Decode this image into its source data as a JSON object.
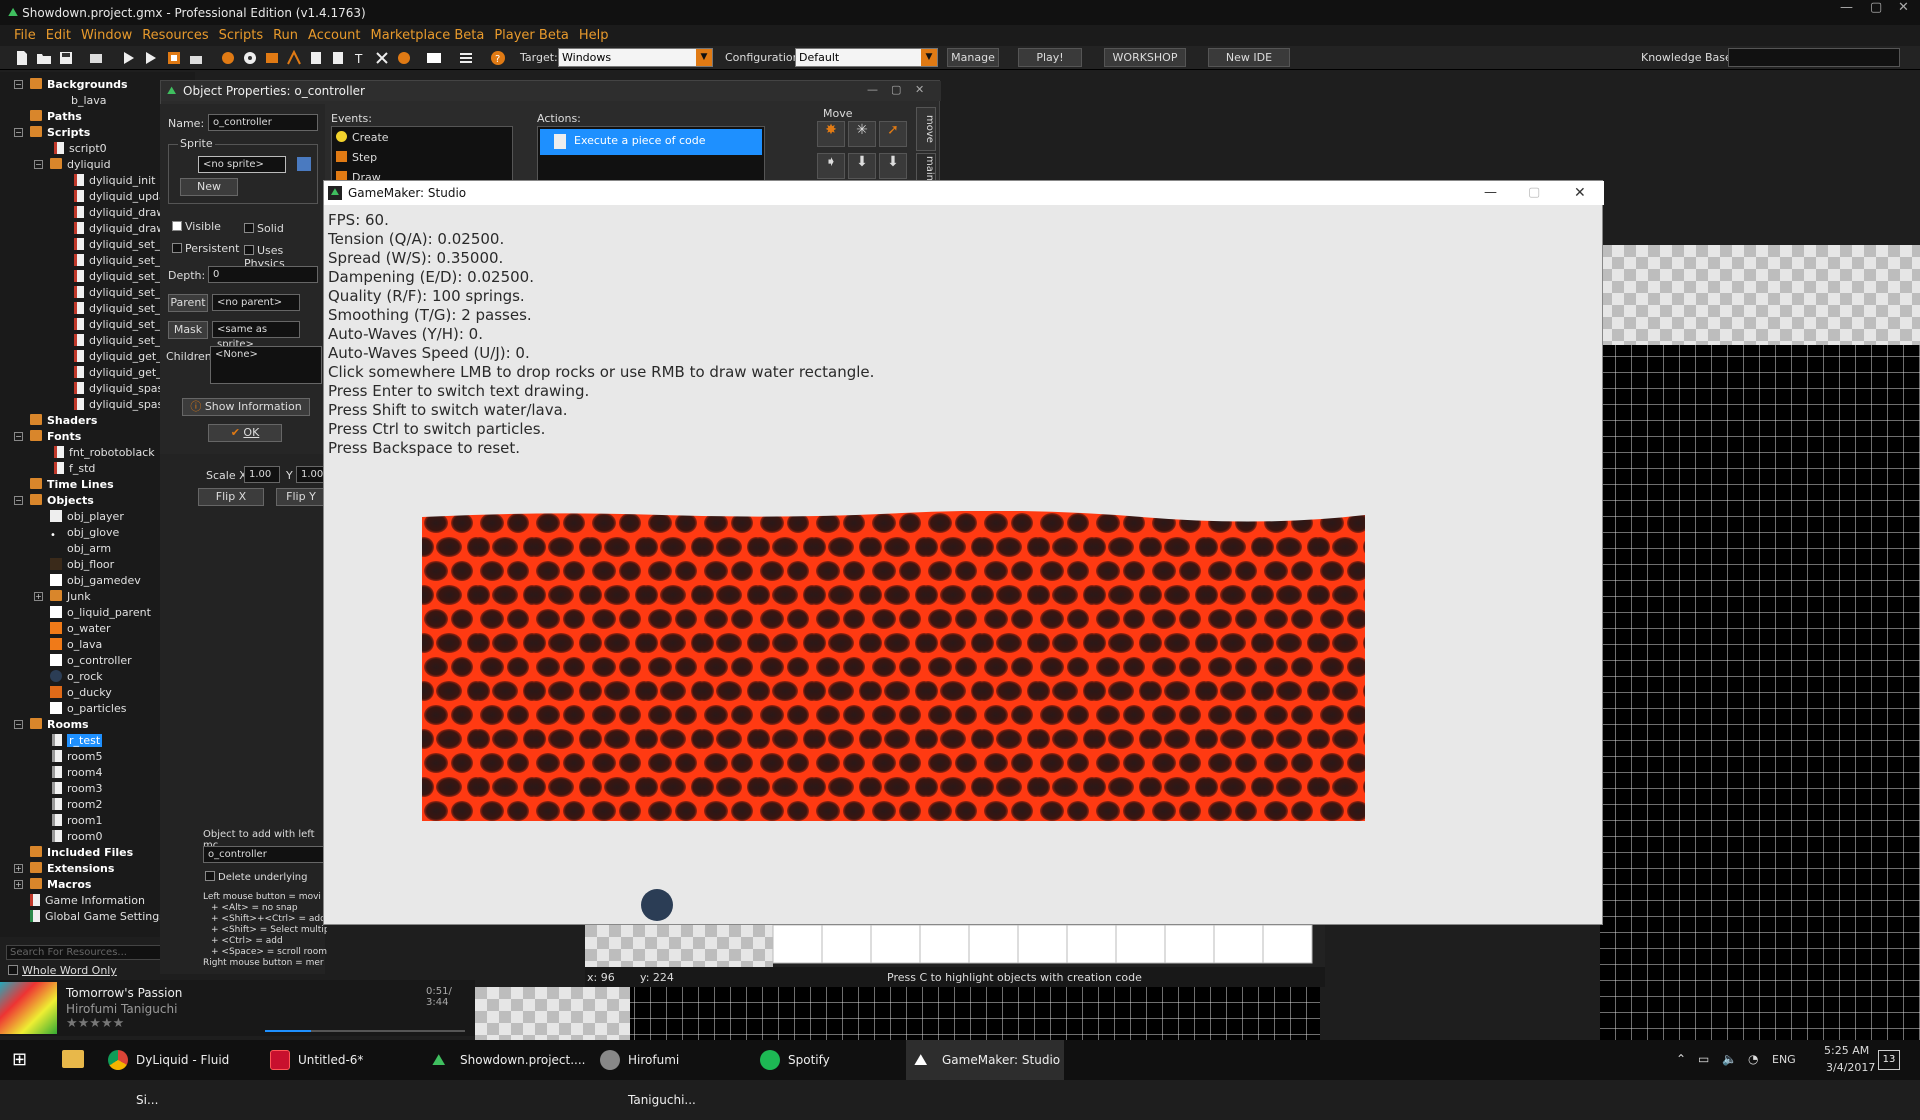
{
  "window": {
    "title": "Showdown.project.gmx - Professional Edition (v1.4.1763)"
  },
  "menu": [
    "File",
    "Edit",
    "Window",
    "Resources",
    "Scripts",
    "Run",
    "Account",
    "Marketplace Beta",
    "Player Beta",
    "Help"
  ],
  "toolbar": {
    "target_label": "Target:",
    "target_value": "Windows",
    "config_label": "Configuration:",
    "config_value": "Default",
    "manage": "Manage",
    "play": "Play!",
    "workshop": "WORKSHOP",
    "new_ide": "New IDE",
    "knowledge_label": "Knowledge Base:"
  },
  "tree": {
    "backgrounds": "Backgrounds",
    "b_lava": "b_lava",
    "paths": "Paths",
    "scripts": "Scripts",
    "script0": "script0",
    "dyliquid": "dyliquid",
    "scripts_list": [
      "dyliquid_init",
      "dyliquid_upda",
      "dyliquid_draw",
      "dyliquid_draw_",
      "dyliquid_set_b",
      "dyliquid_set_c",
      "dyliquid_set_t",
      "dyliquid_set_c",
      "dyliquid_set_s",
      "dyliquid_set_v",
      "dyliquid_set_s",
      "dyliquid_get_c",
      "dyliquid_get_s",
      "dyliquid_spash",
      "dyliquid_spash"
    ],
    "shaders": "Shaders",
    "fonts": "Fonts",
    "fonts_list": [
      "fnt_robotoblack",
      "f_std"
    ],
    "timelines": "Time Lines",
    "objects": "Objects",
    "objects_list": [
      "obj_player",
      "obj_glove",
      "obj_arm",
      "obj_floor",
      "obj_gamedev"
    ],
    "junk": "Junk",
    "objects_list2": [
      "o_liquid_parent",
      "o_water",
      "o_lava",
      "o_controller",
      "o_rock",
      "o_ducky",
      "o_particles"
    ],
    "rooms": "Rooms",
    "rooms_list": [
      "r_test",
      "room5",
      "room4",
      "room3",
      "room2",
      "room1",
      "room0"
    ],
    "included": "Included Files",
    "extensions": "Extensions",
    "macros": "Macros",
    "game_info": "Game Information",
    "global_settings": "Global Game Settings",
    "search_placeholder": "Search For Resources...",
    "whole_word": "Whole Word Only"
  },
  "spotify": {
    "track": "Tomorrow's Passion",
    "artist": "Hirofumi Taniguchi",
    "time": "0:51/ 3:44",
    "stars": "★★★★★"
  },
  "objprops": {
    "title": "Object Properties: o_controller",
    "name_label": "Name:",
    "name_value": "o_controller",
    "sprite_label": "Sprite",
    "sprite_value": "<no sprite>",
    "new": "New",
    "visible": "Visible",
    "solid": "Solid",
    "persistent": "Persistent",
    "uses_physics": "Uses Physics",
    "depth_label": "Depth:",
    "depth_value": "0",
    "parent_btn": "Parent",
    "parent_value": "<no parent>",
    "mask_btn": "Mask",
    "mask_value": "<same as sprite>",
    "children_label": "Children:",
    "children_value": "<None>",
    "show_info": "Show Information",
    "ok": "OK",
    "events_label": "Events:",
    "events": [
      "Create",
      "Step",
      "Draw"
    ],
    "actions_label": "Actions:",
    "action": "Execute a piece of code",
    "move_label": "Move",
    "side_tabs": [
      "move",
      "main"
    ]
  },
  "roomeditor": {
    "scale_label": "Scale X",
    "scale_x": "1.00",
    "scale_y_label": "Y",
    "scale_y": "1.00",
    "flipx": "Flip X",
    "flipy": "Flip Y",
    "add_label": "Object to add with left mc",
    "add_value": "o_controller",
    "delete_underlying": "Delete underlying",
    "help_lines": [
      "Left mouse button = movi",
      "+ <Alt> = no snap",
      "+ <Shift>+<Ctrl> = add n",
      "+ <Shift> = Select multip",
      "+ <Ctrl> = add",
      "+ <Space> = scroll room",
      "Right mouse button = mer"
    ],
    "coord_x": "x: 96",
    "coord_y": "y: 224",
    "status": "Press C to highlight objects with creation code"
  },
  "game": {
    "title": "GameMaker: Studio",
    "lines": [
      "FPS: 60.",
      "Tension (Q/A): 0.02500.",
      "Spread (W/S): 0.35000.",
      "Dampening (E/D): 0.02500.",
      "Quality (R/F): 100 springs.",
      "Smoothing (T/G): 2 passes.",
      "Auto-Waves (Y/H): 0.",
      "Auto-Waves Speed (U/J): 0.",
      "Click somewhere LMB to drop rocks or use RMB to draw water rectangle.",
      "Press Enter to switch text drawing.",
      "Press Shift to switch water/lava.",
      "Press Ctrl to switch particles.",
      "Press Backspace to reset."
    ]
  },
  "taskbar": {
    "items": [
      "DyLiquid - Fluid Si...",
      "Untitled-6*",
      "Showdown.project....",
      "Hirofumi Taniguchi...",
      "Spotify",
      "GameMaker: Studio"
    ],
    "lang": "ENG",
    "time": "5:25 AM",
    "date": "3/4/2017",
    "notif": "13"
  },
  "colors": {
    "accent": "#e89a2c",
    "lava_glow": "#ff3a12",
    "lava_dark": "#2a1210",
    "selection": "#1e90ff"
  }
}
